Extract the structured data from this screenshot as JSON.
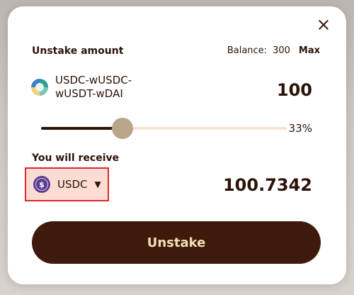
{
  "modal": {
    "title": "Unstake amount",
    "balance_label": "Balance:",
    "balance_value": "300",
    "max_label": "Max",
    "lp_token_name": "USDC-wUSDC-wUSDT-wDAI",
    "amount": "100",
    "slider_percent": 33,
    "slider_percent_label": "33%",
    "receive_label": "You will receive",
    "receive_token": "USDC",
    "receive_amount": "100.7342",
    "action_label": "Unstake"
  },
  "icons": {
    "close": "close-icon",
    "lp_token": "lp-token-icon",
    "usdc": "usdc-icon",
    "dropdown": "chevron-down-icon"
  },
  "colors": {
    "primary": "#3d1a0c",
    "text": "#2b1407",
    "button_text": "#f2e0b8",
    "slider_thumb": "#b9a587",
    "slider_track": "#f6e4d4",
    "highlight_border": "#e0262b",
    "highlight_fill": "#fddcd3",
    "usdc": "#5c3d8f"
  }
}
